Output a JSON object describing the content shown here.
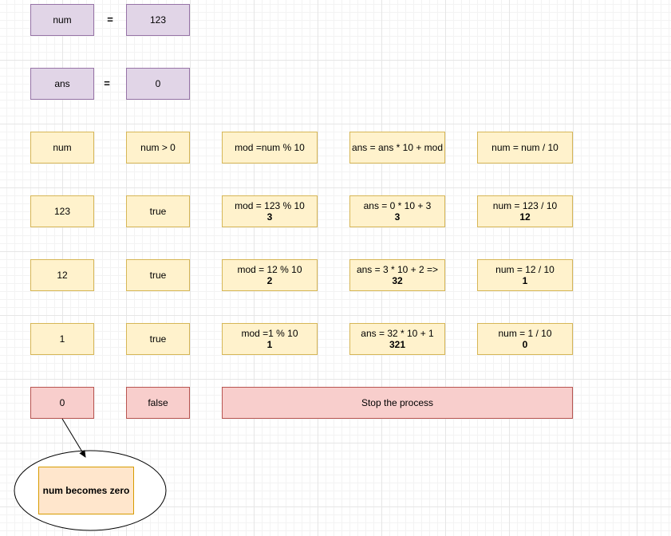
{
  "vars": {
    "num_label": "num",
    "num_value": "123",
    "ans_label": "ans",
    "ans_value": "0",
    "equals": "="
  },
  "headers": {
    "c0": "num",
    "c1": "num > 0",
    "c2": "mod =num % 10",
    "c3": "ans = ans * 10 + mod",
    "c4": "num = num / 10"
  },
  "rows": [
    {
      "num": "123",
      "cond": "true",
      "mod_expr": "mod = 123 % 10",
      "mod_res": "3",
      "ans_expr": "ans = 0 * 10 + 3",
      "ans_res": "3",
      "div_expr": "num = 123 / 10",
      "div_res": "12"
    },
    {
      "num": "12",
      "cond": "true",
      "mod_expr": "mod = 12 % 10",
      "mod_res": "2",
      "ans_expr": "ans = 3 * 10 + 2 =>",
      "ans_res": "32",
      "div_expr": "num = 12 / 10",
      "div_res": "1"
    },
    {
      "num": "1",
      "cond": "true",
      "mod_expr": "mod =1 % 10",
      "mod_res": "1",
      "ans_expr": "ans = 32 * 10 + 1",
      "ans_res": "321",
      "div_expr": "num = 1 / 10",
      "div_res": "0"
    }
  ],
  "final": {
    "num": "0",
    "cond": "false",
    "stop": "Stop the process"
  },
  "note": "num becomes zero",
  "colors": {
    "purple_fill": "#e1d5e7",
    "purple_stroke": "#9673a6",
    "yellow_fill": "#fff2cc",
    "yellow_stroke": "#d6b656",
    "red_fill": "#f8cecc",
    "red_stroke": "#b85450",
    "orange_fill": "#ffe6cc",
    "orange_stroke": "#d79b00"
  }
}
